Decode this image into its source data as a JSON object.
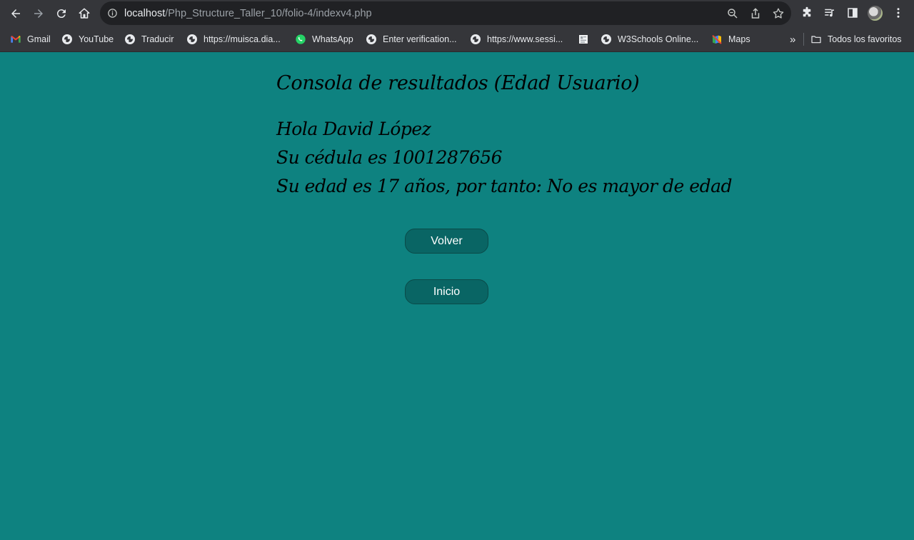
{
  "browser": {
    "url_host": "localhost",
    "url_path": "/Php_Structure_Taller_10/folio-4/indexv4.php"
  },
  "bookmarks": {
    "items": [
      {
        "label": "Gmail",
        "icon": "gmail-icon"
      },
      {
        "label": "YouTube",
        "icon": "globe-icon"
      },
      {
        "label": "Traducir",
        "icon": "globe-icon"
      },
      {
        "label": "https://muisca.dia...",
        "icon": "globe-icon"
      },
      {
        "label": "WhatsApp",
        "icon": "whatsapp-icon"
      },
      {
        "label": "Enter verification...",
        "icon": "globe-icon"
      },
      {
        "label": "https://www.sessi...",
        "icon": "globe-icon"
      },
      {
        "label": "",
        "icon": "page-thumbnail-icon"
      },
      {
        "label": "W3Schools Online...",
        "icon": "globe-icon"
      },
      {
        "label": "Maps",
        "icon": "maps-icon"
      }
    ],
    "overflow": "»",
    "all_bookmarks": "Todos los favoritos"
  },
  "content": {
    "title": "Consola de resultados (Edad Usuario)",
    "greeting": "Hola David López",
    "id_line": "Su cédula es 1001287656",
    "age_line": "Su edad es 17 años, por tanto: No es mayor de edad"
  },
  "buttons": {
    "back_label": "Volver",
    "home_label": "Inicio"
  },
  "colors": {
    "page_background": "#0e8280",
    "button_background": "#096564"
  }
}
